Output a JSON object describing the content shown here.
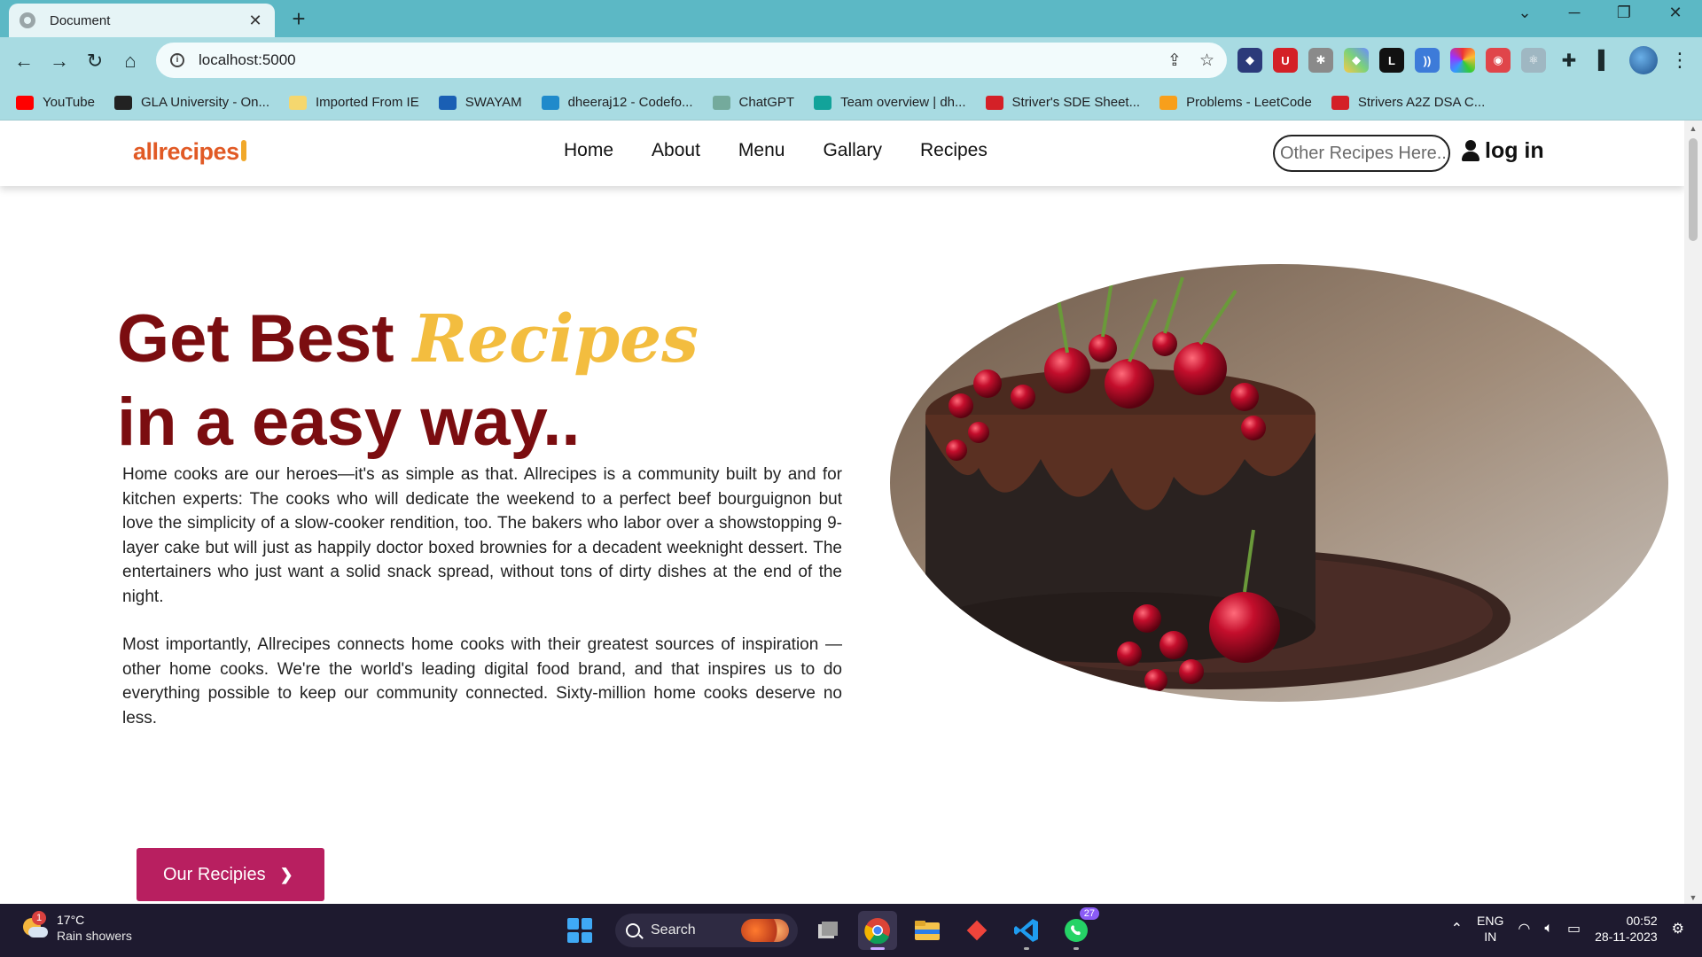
{
  "browser": {
    "tab_title": "Document",
    "tab_close": "✕",
    "new_tab": "+",
    "url": "localhost:5000",
    "window_controls": [
      "⌄",
      "─",
      "❐",
      "✕"
    ],
    "bookmarks": [
      {
        "label": "YouTube",
        "icon": "youtube-icon",
        "color": "#ff0000"
      },
      {
        "label": "GLA University - On...",
        "icon": "gla-icon",
        "color": "#222222"
      },
      {
        "label": "Imported From IE",
        "icon": "folder-icon",
        "color": "#f5d76e"
      },
      {
        "label": "SWAYAM",
        "icon": "swayam-icon",
        "color": "#1a5fb4"
      },
      {
        "label": "dheeraj12 - Codefo...",
        "icon": "codeforces-icon",
        "color": "#1f8acb"
      },
      {
        "label": "ChatGPT",
        "icon": "chatgpt-icon",
        "color": "#74aa9c"
      },
      {
        "label": "Team overview | dh...",
        "icon": "diamond-icon",
        "color": "#12a39a"
      },
      {
        "label": "Striver's SDE Sheet...",
        "icon": "tuf-icon",
        "color": "#d42027"
      },
      {
        "label": "Problems - LeetCode",
        "icon": "leetcode-icon",
        "color": "#f89f1b"
      },
      {
        "label": "Strivers A2Z DSA C...",
        "icon": "tuf-icon",
        "color": "#d42027"
      }
    ]
  },
  "site": {
    "logo": "allrecipes",
    "nav": [
      "Home",
      "About",
      "Menu",
      "Gallary",
      "Recipes"
    ],
    "search_placeholder": "Other Recipes Here..",
    "login_label": "log in",
    "hero": {
      "title_part1": "Get Best ",
      "title_accent": "Recipes",
      "title_line2": "in a easy way..",
      "paragraph1": "Home cooks are our heroes—it's as simple as that. Allrecipes is a community built by and for kitchen experts: The cooks who will dedicate the weekend to a perfect beef bourguignon but love the simplicity of a slow-cooker rendition, too. The bakers who labor over a showstopping 9-layer cake but will just as happily doctor boxed brownies for a decadent weeknight dessert. The entertainers who just want a solid snack spread, without tons of dirty dishes at the end of the night.",
      "paragraph2": "Most importantly, Allrecipes connects home cooks with their greatest sources of inspiration — other home cooks. We're the world's leading digital food brand, and that inspires us to do everything possible to keep our community connected. Sixty-million home cooks deserve no less."
    },
    "cta_label": "Our Recipies",
    "colors": {
      "title": "#7b0d10",
      "accent": "#f3bd3f",
      "cta": "#b81f60",
      "logo": "#e15a25"
    }
  },
  "taskbar": {
    "weather_badge": "1",
    "temperature": "17°C",
    "weather_desc": "Rain showers",
    "search_label": "Search",
    "whatsapp_badge": "27",
    "lang_line1": "ENG",
    "lang_line2": "IN",
    "time": "00:52",
    "date": "28-11-2023"
  }
}
